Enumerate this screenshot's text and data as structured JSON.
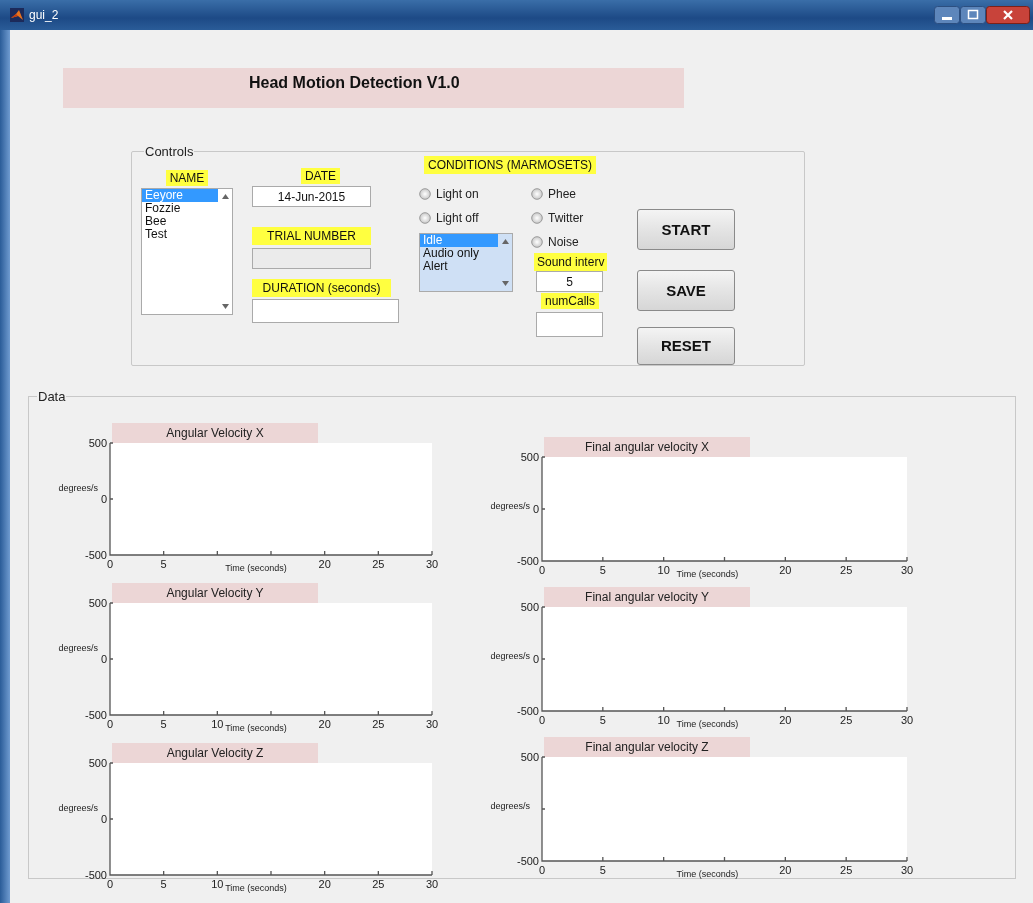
{
  "window": {
    "title": "gui_2"
  },
  "header": {
    "title": "Head Motion Detection V1.0"
  },
  "controls": {
    "title": "Controls",
    "name": {
      "label": "NAME",
      "items": [
        {
          "text": "Eeyore",
          "selected": true
        },
        {
          "text": "Fozzie",
          "selected": false
        },
        {
          "text": "Bee",
          "selected": false
        },
        {
          "text": "Test",
          "selected": false
        }
      ]
    },
    "date": {
      "label": "DATE",
      "value": "14-Jun-2015"
    },
    "trial_number": {
      "label": "TRIAL NUMBER",
      "disabled": true
    },
    "duration": {
      "label": "DURATION (seconds)",
      "disabled": false
    },
    "conditions": {
      "label": "CONDITIONS (MARMOSETS)",
      "light_options": [
        {
          "label": "Light on",
          "selected": false
        },
        {
          "label": "Light off",
          "selected": false
        }
      ],
      "modes": [
        {
          "text": "Idle",
          "selected": true
        },
        {
          "text": "Audio only",
          "selected": false
        },
        {
          "text": "Alert",
          "selected": false
        }
      ],
      "call_options": [
        {
          "label": "Phee",
          "selected": false
        },
        {
          "label": "Twitter",
          "selected": false
        },
        {
          "label": "Noise",
          "selected": false
        }
      ],
      "sound_interval": {
        "label": "Sound  interv",
        "value": "5"
      },
      "num_calls": {
        "label": "numCalls"
      }
    },
    "buttons": [
      "START",
      "SAVE",
      "RESET"
    ]
  },
  "data": {
    "title": "Data",
    "plots": [
      {
        "chart_data": {
          "type": "line",
          "title": "Angular Velocity X",
          "xlabel": "Time (seconds)",
          "ylabel": "degrees/s",
          "xlim": [
            0,
            30
          ],
          "ylim": [
            -500,
            500
          ],
          "xticks": [
            0,
            5,
            20,
            25,
            30
          ],
          "yticks": [
            -500,
            0,
            500
          ]
        }
      },
      {
        "chart_data": {
          "type": "line",
          "title": "Angular Velocity Y",
          "xlabel": "Time (seconds)",
          "ylabel": "degrees/s",
          "xlim": [
            0,
            30
          ],
          "ylim": [
            -500,
            500
          ],
          "xticks": [
            0,
            5,
            10,
            20,
            25,
            30
          ],
          "yticks": [
            -500,
            0,
            500
          ]
        }
      },
      {
        "chart_data": {
          "type": "line",
          "title": "Angular Velocity Z",
          "xlabel": "Time (seconds)",
          "ylabel": "degrees/s",
          "xlim": [
            0,
            30
          ],
          "ylim": [
            -500,
            500
          ],
          "xticks": [
            0,
            5,
            10,
            20,
            25,
            30
          ],
          "yticks": [
            -500,
            0,
            500
          ]
        }
      },
      {
        "chart_data": {
          "type": "line",
          "title": "Final angular velocity X",
          "xlabel": "Time (seconds)",
          "ylabel": "degrees/s",
          "xlim": [
            0,
            30
          ],
          "ylim": [
            -500,
            500
          ],
          "xticks": [
            0,
            5,
            10,
            20,
            25,
            30
          ],
          "yticks": [
            -500,
            0,
            500
          ]
        }
      },
      {
        "chart_data": {
          "type": "line",
          "title": "Final angular velocity Y",
          "xlabel": "Time (seconds)",
          "ylabel": "degrees/s",
          "xlim": [
            0,
            30
          ],
          "ylim": [
            -500,
            500
          ],
          "xticks": [
            0,
            5,
            10,
            20,
            25,
            30
          ],
          "yticks": [
            -500,
            0,
            500
          ]
        }
      },
      {
        "chart_data": {
          "type": "line",
          "title": "Final angular velocity Z",
          "xlabel": "Time (seconds)",
          "ylabel": "degrees/s",
          "xlim": [
            0,
            30
          ],
          "ylim": [
            -500,
            500
          ],
          "xticks": [
            0,
            5,
            20,
            25,
            30
          ],
          "yticks": [
            -500,
            500
          ]
        }
      }
    ]
  }
}
